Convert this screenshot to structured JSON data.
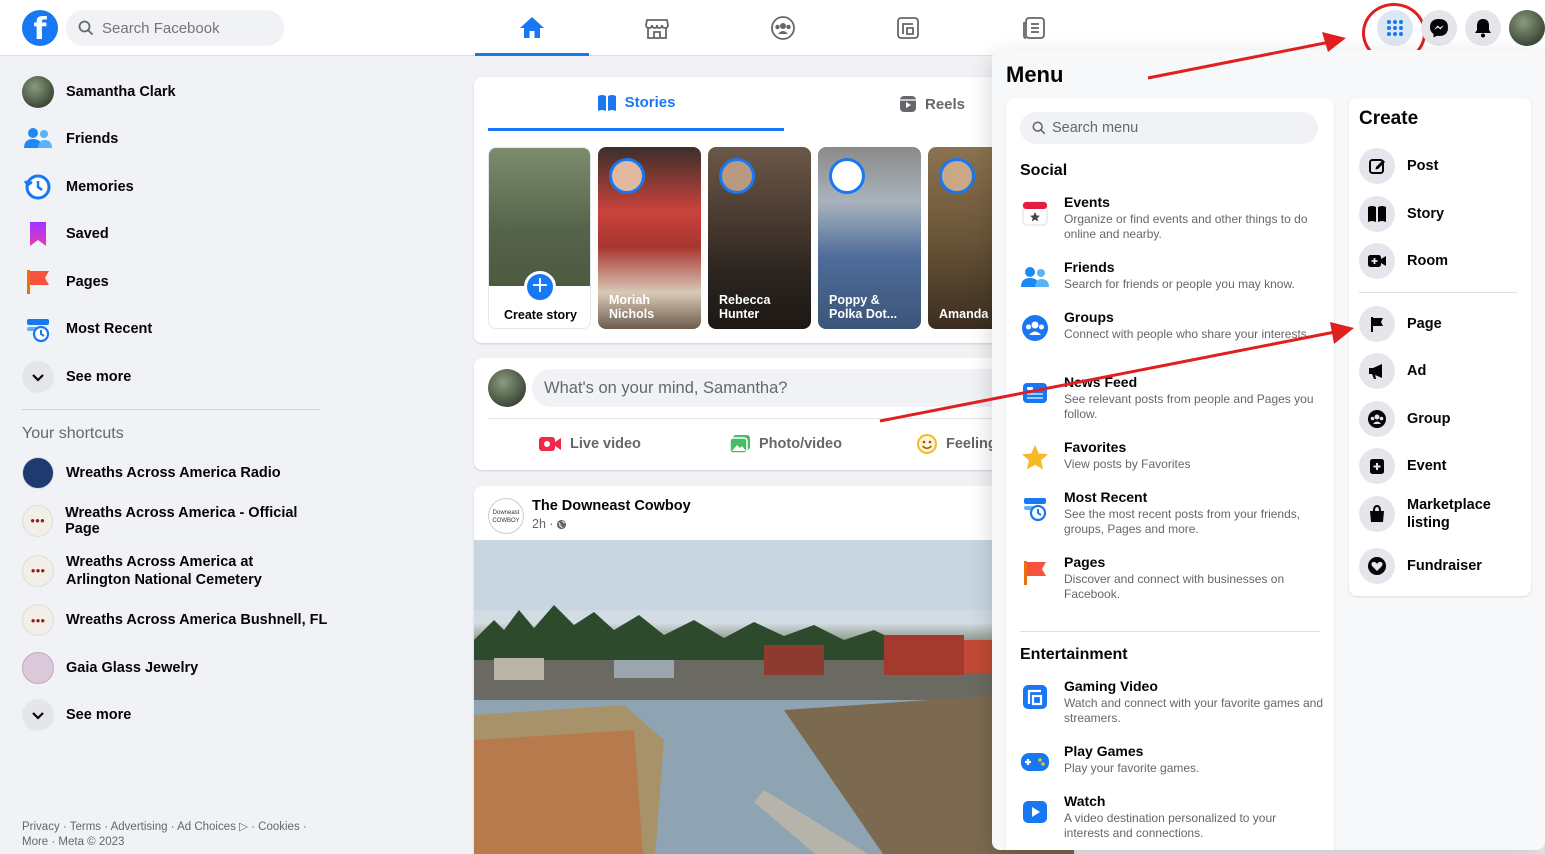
{
  "search": {
    "placeholder": "Search Facebook"
  },
  "nav_tabs": [
    "home-icon",
    "marketplace-icon",
    "groups-icon",
    "gaming-icon",
    "news-icon"
  ],
  "left_sidebar": {
    "items": [
      {
        "label": "Samantha Clark",
        "icon": "avatar"
      },
      {
        "label": "Friends",
        "icon": "friends-icon"
      },
      {
        "label": "Memories",
        "icon": "memories-icon"
      },
      {
        "label": "Saved",
        "icon": "saved-icon"
      },
      {
        "label": "Pages",
        "icon": "pages-icon"
      },
      {
        "label": "Most Recent",
        "icon": "most-recent-icon"
      },
      {
        "label": "See more",
        "icon": "chevron-down-icon"
      }
    ],
    "shortcuts_title": "Your shortcuts",
    "shortcuts": [
      {
        "label": "Wreaths Across America Radio"
      },
      {
        "label": "Wreaths Across America - Official Page"
      },
      {
        "label": "Wreaths Across America at Arlington National Cemetery"
      },
      {
        "label": "Wreaths Across America Bushnell, FL"
      },
      {
        "label": "Gaia Glass Jewelry"
      },
      {
        "label": "See more"
      }
    ],
    "footer": "Privacy · Terms · Advertising · Ad Choices ▷ · Cookies · More · Meta © 2023"
  },
  "stories": {
    "tabs": [
      "Stories",
      "Reels"
    ],
    "create_label": "Create story",
    "items": [
      {
        "name": "Moriah Nichols"
      },
      {
        "name": "Rebecca Hunter"
      },
      {
        "name": "Poppy & Polka Dot..."
      },
      {
        "name": "Amanda L"
      }
    ]
  },
  "composer": {
    "placeholder": "What's on your mind, Samantha?",
    "actions": [
      "Live video",
      "Photo/video",
      "Feeling"
    ]
  },
  "post": {
    "author": "The Downeast Cowboy",
    "time": "2h · ",
    "logo_text": "Downeast COWBOY"
  },
  "menu": {
    "title": "Menu",
    "search_placeholder": "Search menu",
    "sections": [
      {
        "title": "Social",
        "items": [
          {
            "title": "Events",
            "desc": "Organize or find events and other things to do online and nearby.",
            "icon": "events-icon",
            "color": "#e41e3f"
          },
          {
            "title": "Friends",
            "desc": "Search for friends or people you may know.",
            "icon": "friends-icon",
            "color": "#1877f2"
          },
          {
            "title": "Groups",
            "desc": "Connect with people who share your interests.",
            "icon": "groups-icon",
            "color": "#1877f2"
          },
          {
            "title": "News Feed",
            "desc": "See relevant posts from people and Pages you follow.",
            "icon": "news-feed-icon",
            "color": "#1877f2"
          },
          {
            "title": "Favorites",
            "desc": "View posts by Favorites",
            "icon": "star-icon",
            "color": "#f7b928"
          },
          {
            "title": "Most Recent",
            "desc": "See the most recent posts from your friends, groups, Pages and more.",
            "icon": "most-recent-icon",
            "color": "#1877f2"
          },
          {
            "title": "Pages",
            "desc": "Discover and connect with businesses on Facebook.",
            "icon": "pages-flag-icon",
            "color": "#f5533d"
          }
        ]
      },
      {
        "title": "Entertainment",
        "items": [
          {
            "title": "Gaming Video",
            "desc": "Watch and connect with your favorite games and streamers.",
            "icon": "gaming-video-icon",
            "color": "#1877f2"
          },
          {
            "title": "Play Games",
            "desc": "Play your favorite games.",
            "icon": "play-games-icon",
            "color": "#1877f2"
          },
          {
            "title": "Watch",
            "desc": "A video destination personalized to your interests and connections.",
            "icon": "watch-icon",
            "color": "#1877f2"
          }
        ]
      }
    ]
  },
  "create": {
    "title": "Create",
    "items": [
      {
        "label": "Post",
        "icon": "compose-icon"
      },
      {
        "label": "Story",
        "icon": "story-icon"
      },
      {
        "label": "Room",
        "icon": "room-video-icon"
      },
      {
        "label": "Page",
        "icon": "page-flag-icon"
      },
      {
        "label": "Ad",
        "icon": "megaphone-icon"
      },
      {
        "label": "Group",
        "icon": "group-icon"
      },
      {
        "label": "Event",
        "icon": "event-icon"
      },
      {
        "label": "Marketplace listing",
        "icon": "marketplace-bag-icon"
      },
      {
        "label": "Fundraiser",
        "icon": "fundraiser-icon"
      }
    ]
  },
  "colors": {
    "brand": "#1877f2",
    "annotation": "#e02020"
  }
}
